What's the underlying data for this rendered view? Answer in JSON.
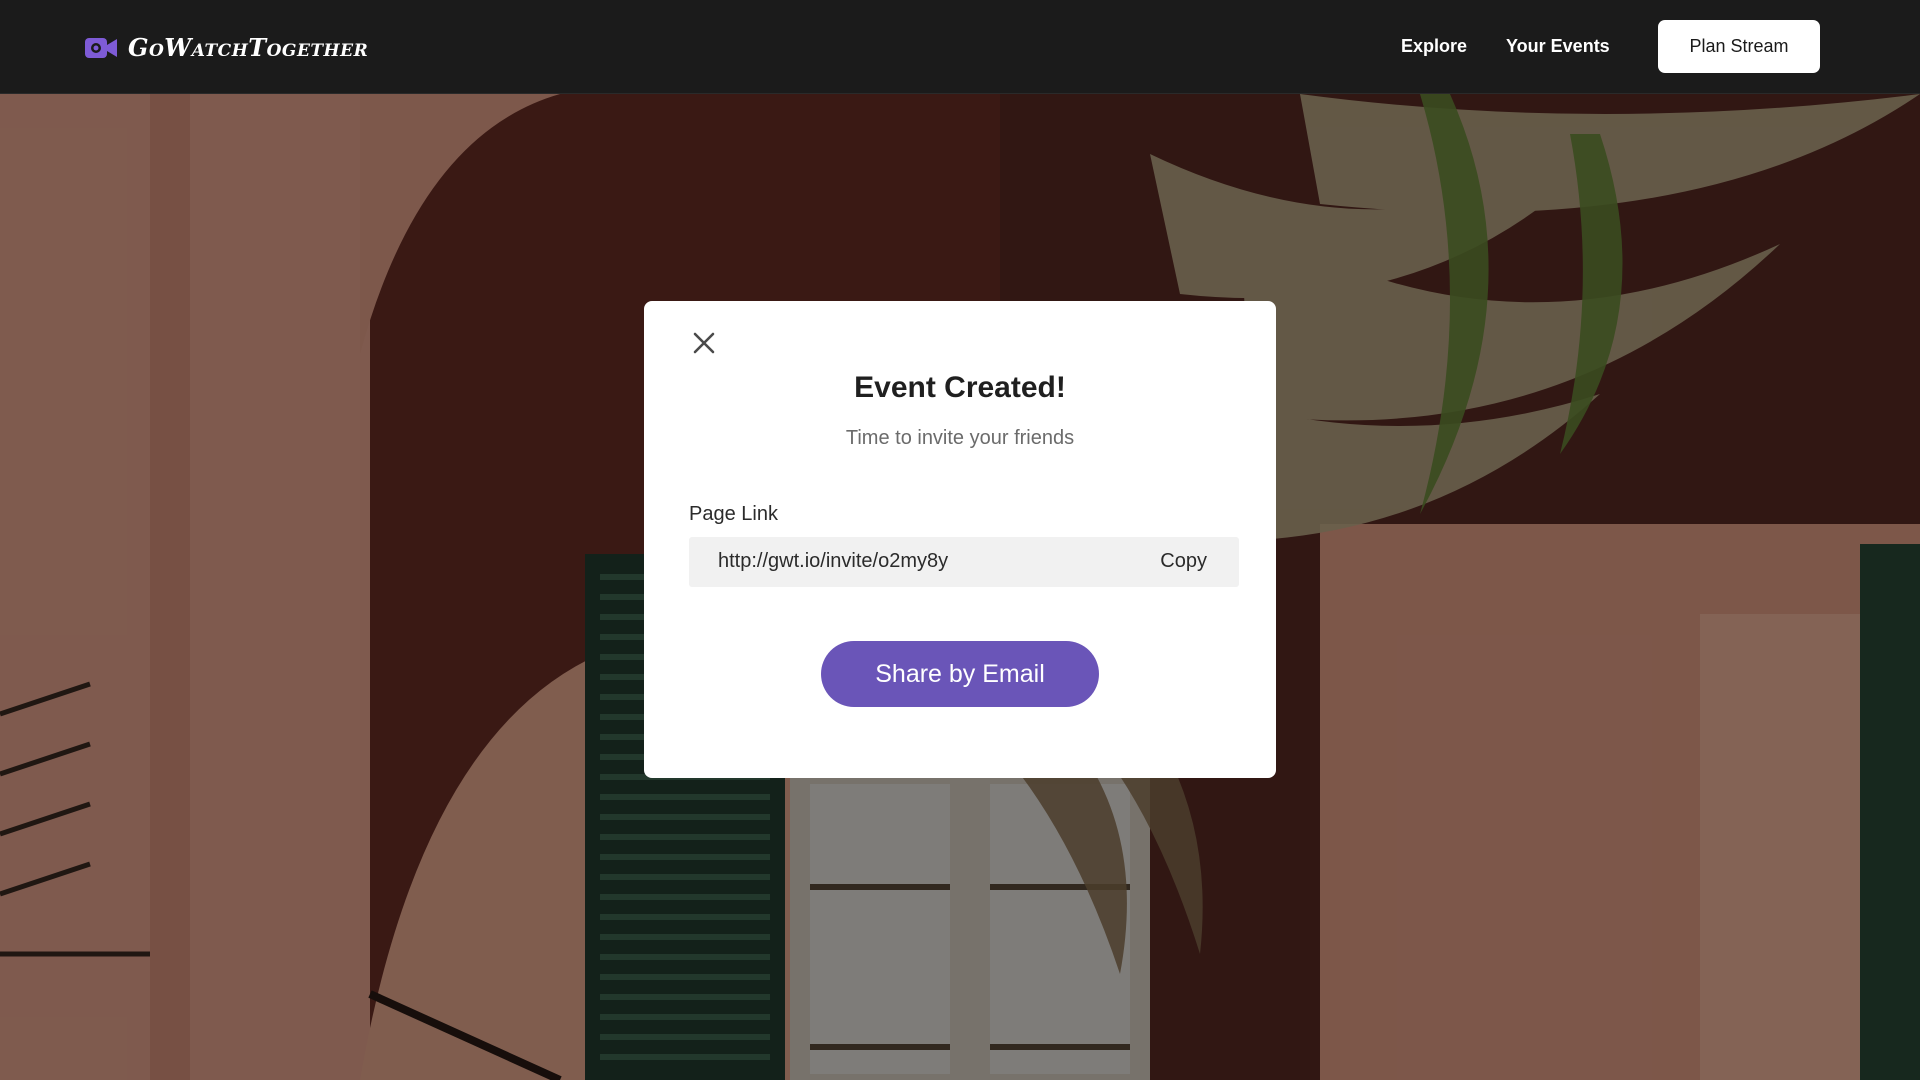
{
  "app": {
    "brand_name": "GoWatchTogether",
    "brand_icon": "video-camera-icon"
  },
  "nav": {
    "links": [
      "Explore",
      "Your Events"
    ],
    "cta_label": "Plan Stream"
  },
  "modal": {
    "title": "Event Created!",
    "subtitle": "Time to invite your friends",
    "link_label": "Page Link",
    "link_value": "http://gwt.io/invite/o2my8y",
    "copy_label": "Copy",
    "share_label": "Share by Email",
    "close_icon": "close-icon"
  },
  "colors": {
    "accent": "#6a55b8",
    "nav_bg": "#1b1b1b",
    "logo_purple": "#7e5bd6"
  }
}
